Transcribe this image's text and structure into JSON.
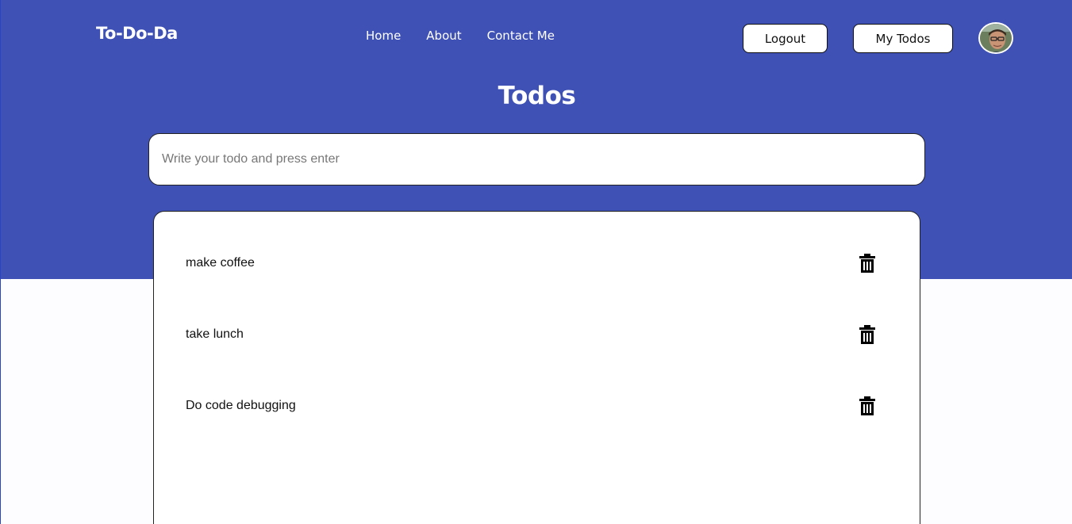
{
  "header": {
    "brand": "To-Do-Da",
    "nav": [
      "Home",
      "About",
      "Contact Me"
    ],
    "logout_label": "Logout",
    "mytodos_label": "My Todos",
    "avatar_icon": "user-avatar"
  },
  "main": {
    "title": "Todos",
    "input_placeholder": "Write your todo and press enter",
    "input_value": "",
    "todos": [
      {
        "text": "make coffee",
        "icon": "trash-icon"
      },
      {
        "text": "take lunch",
        "icon": "trash-icon"
      },
      {
        "text": "Do code debugging",
        "icon": "trash-icon"
      }
    ]
  },
  "colors": {
    "header_bg": "#3f51b5",
    "page_bg": "#fdfdff",
    "card_bg": "#ffffff",
    "text": "#111111"
  }
}
